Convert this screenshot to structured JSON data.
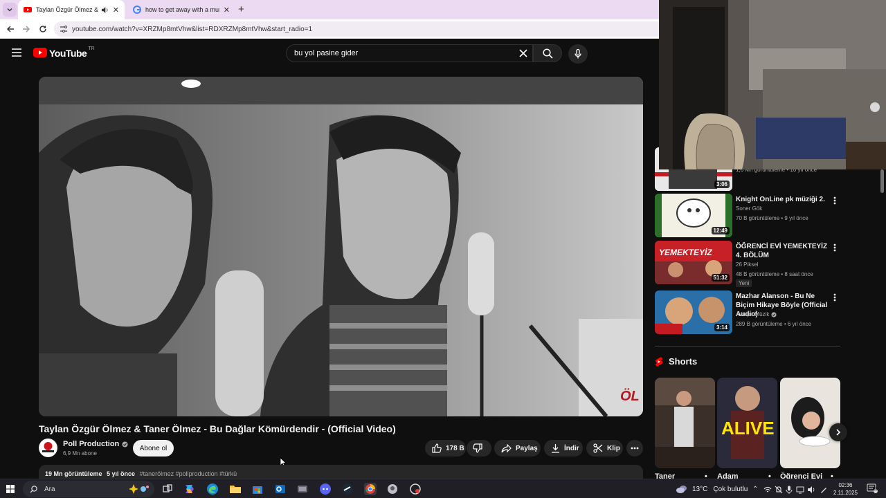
{
  "browser": {
    "tabs": [
      {
        "title": "Taylan Özgür Ölmez & Tane",
        "active": true,
        "audio": true
      },
      {
        "title": "how to get away with a murder",
        "active": false
      }
    ],
    "url": "youtube.com/watch?v=XRZMp8mtVhw&list=RDXRZMp8mtVhw&start_radio=1"
  },
  "youtube": {
    "logo_text": "YouTube",
    "country_code": "TR",
    "search_query": "bu yol pasine gider"
  },
  "video": {
    "title": "Taylan Özgür Ölmez & Taner Ölmez - Bu Dağlar Kömürdendir - (Official Video)",
    "channel": "Poll Production",
    "subscribers": "6,9 Mn abone",
    "subscribe_label": "Abone ol",
    "likes": "178 B",
    "share_label": "Paylaş",
    "download_label": "İndir",
    "clip_label": "Klip",
    "views": "19 Mn görüntüleme",
    "age": "5 yıl önce",
    "hashtags": "#tanerölmez #pollproduction #türkü",
    "watermark": "ÖL"
  },
  "recommendations": [
    {
      "title": "",
      "channel": "",
      "meta": "1,6 Mn görüntüleme • 10 yıl önce",
      "duration": "3:06",
      "thumb_color": "#e8e8e8",
      "thumb_accent": "#c21b22"
    },
    {
      "title": "Knight OnLine pk müziği 2.",
      "channel": "Soner Gök",
      "meta": "70 B görüntüleme • 9 yıl önce",
      "duration": "12:49",
      "thumb_color": "#f2efe4",
      "thumb_accent": "#2c6f2a"
    },
    {
      "title": "ÖĞRENCİ EVİ YEMEKTEYİZ 4. BÖLÜM",
      "channel": "26 Piksel",
      "meta": "48 B görüntüleme • 8 saat önce",
      "duration": "51:32",
      "badge": "Yeni",
      "thumb_color": "#c72026",
      "thumb_accent": "#ffffff",
      "thumb_text": "YEMEKTEYİZ"
    },
    {
      "title": "Mazhar Alanson - Bu Ne Biçim Hikaye Böyle (Official Audio)",
      "channel": "Avrupa Müzik",
      "meta": "289 B görüntüleme • 6 yıl önce",
      "duration": "3:14",
      "verified": true,
      "thumb_color": "#2a6fa8",
      "thumb_accent": "#d8a57a"
    }
  ],
  "shorts": {
    "heading": "Shorts",
    "items": [
      {
        "label": "Taner",
        "thumb_color": "#3b2f2a",
        "thumb_text": ""
      },
      {
        "label": "Adam",
        "thumb_color": "#2a2a3a",
        "thumb_text": "ALIVE"
      },
      {
        "label": "Öğrenci Evi",
        "thumb_color": "#e9e4de",
        "thumb_text": ""
      }
    ]
  },
  "taskbar": {
    "search_placeholder": "Ara",
    "weather": "13°C",
    "weather_desc": "Çok bulutlu",
    "time": "02:36",
    "date": "2.11.2025"
  },
  "colors": {
    "brand_red": "#ff0000",
    "yt_bg": "#0f0f0f",
    "tab_strip": "#ecd9f2"
  }
}
